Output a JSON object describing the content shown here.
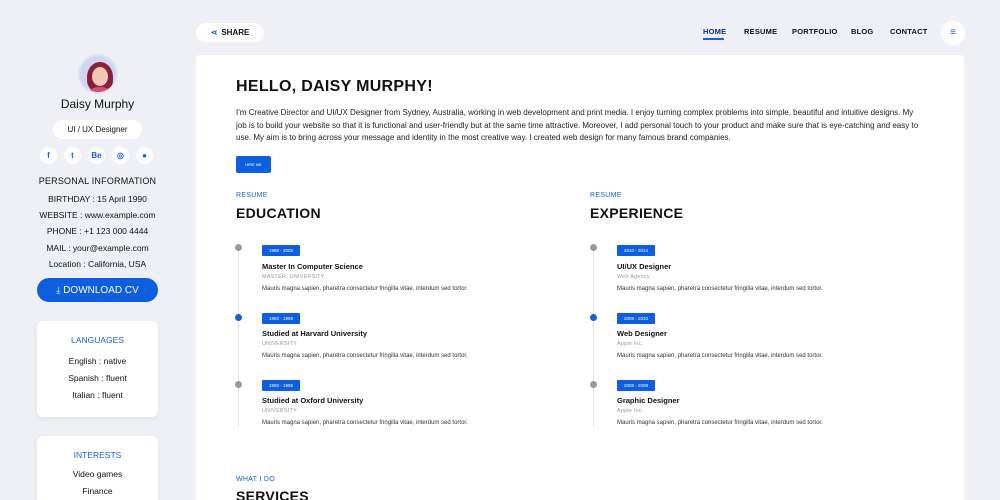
{
  "profile": {
    "name": "Daisy Murphy",
    "role": "UI / UX Designer",
    "socials": [
      {
        "icon": "facebook-icon",
        "glyph": "f"
      },
      {
        "icon": "twitter-icon",
        "glyph": "t"
      },
      {
        "icon": "behance-icon",
        "glyph": "Be"
      },
      {
        "icon": "dribbble-icon",
        "glyph": "◎"
      },
      {
        "icon": "github-icon",
        "glyph": "●"
      }
    ],
    "personal_title": "PERSONAL INFORMATION",
    "info": [
      "BIRTHDAY : 15 April 1990",
      "WEBSITE : www.example.com",
      "PHONE : +1 123 000 4444",
      "MAIL : your@example.com",
      "Location : California, USA"
    ],
    "download_label": "DOWNLOAD CV",
    "download_icon": "download-icon"
  },
  "languages": {
    "title": "LANGUAGES",
    "items": [
      "English : native",
      "Spanish : fluent",
      "Italian : fluent"
    ]
  },
  "interests": {
    "title": "INTERESTS",
    "items": [
      "Video games",
      "Finance"
    ]
  },
  "topbar": {
    "share_label": "SHARE",
    "share_icon": "share-icon",
    "nav": [
      {
        "label": "HOME",
        "active": true
      },
      {
        "label": "RESUME",
        "active": false
      },
      {
        "label": "PORTFOLIO",
        "active": false
      },
      {
        "label": "BLOG",
        "active": false
      },
      {
        "label": "CONTACT",
        "active": false
      }
    ],
    "menu_icon": "hamburger-icon"
  },
  "main": {
    "hello": "HELLO, DAISY MURPHY!",
    "intro": "I'm Creative Director and UI/UX Designer from Sydney, Australia, working in web development and print media. I enjoy turning complex problems into simple, beautiful and intuitive designs. My job is to build your website so that it is functional and user-friendly but at the same time attractive. Moreover, I add personal touch to your product and make sure that is eye-catching and easy to use. My aim is to bring across your message and identity in the most creative way. I created web design for many famous brand companies.",
    "hire_label": "HIRE ME",
    "education": {
      "label": "RESUME",
      "title": "EDUCATION",
      "items": [
        {
          "years": "1998 - 2003",
          "title": "Master In Computer Science",
          "sub": "MASTER, UNIVERSITY",
          "desc": "Mauris magna sapien, pharetra consectetur fringilla vitae, interdum sed tortor."
        },
        {
          "years": "1993 - 1998",
          "title": "Studied at Harvard University",
          "sub": "UNIVERSITY",
          "desc": "Mauris magna sapien, pharetra consectetur fringilla vitae, interdum sed tortor."
        },
        {
          "years": "1993 - 1995",
          "title": "Studied at Oxford University",
          "sub": "UNIVERSITY",
          "desc": "Mauris magna sapien, pharetra consectetur fringilla vitae, interdum sed tortor."
        }
      ]
    },
    "experience": {
      "label": "RESUME",
      "title": "EXPERIENCE",
      "items": [
        {
          "years": "2010 - 2014",
          "title": "UI/UX Designer",
          "sub": "Web Agency",
          "desc": "Mauris magna sapien, pharetra consectetur fringilla vitae, interdum sed tortor."
        },
        {
          "years": "2008 - 2010",
          "title": "Web Designer",
          "sub": "Apple Inc.",
          "desc": "Mauris magna sapien, pharetra consectetur fringilla vitae, interdum sed tortor."
        },
        {
          "years": "2008 - 2008",
          "title": "Graphic Designer",
          "sub": "Apple Inc.",
          "desc": "Mauris magna sapien, pharetra consectetur fringilla vitae, interdum sed tortor."
        }
      ]
    },
    "services": {
      "label": "WHAT I DO",
      "title": "SERVICES"
    }
  }
}
